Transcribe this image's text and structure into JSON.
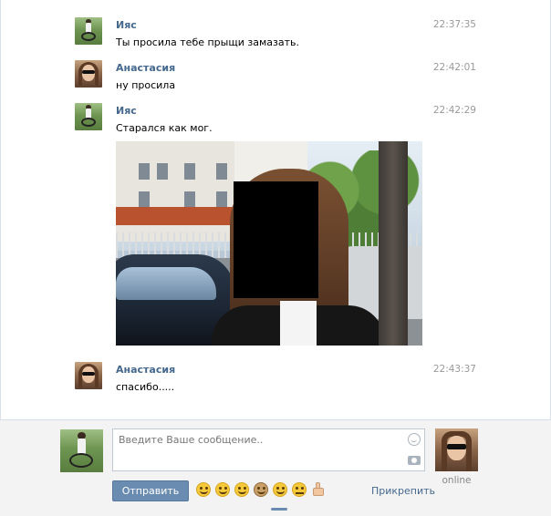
{
  "messages": [
    {
      "author": "Ияс",
      "time": "22:37:35",
      "text": "Ты просила тебе прыщи замазать."
    },
    {
      "author": "Анастасия",
      "time": "22:42:01",
      "text": "ну просила"
    },
    {
      "author": "Ияс",
      "time": "22:42:29",
      "text": "Старался как мог."
    },
    {
      "author": "Анастасия",
      "time": "22:43:37",
      "text": "спасибо....."
    }
  ],
  "composer": {
    "placeholder": "Введите Ваше сообщение..",
    "send_label": "Отправить",
    "attach_label": "Прикрепить",
    "peer_status": "online",
    "emoji": [
      "laughing-emoji",
      "smile-emoji",
      "grin-emoji",
      "cowboy-emoji",
      "cheeky-emoji",
      "neutral-emoji",
      "thumbs-up-emoji"
    ]
  },
  "colors": {
    "author_link": "#45688e",
    "timestamp": "#999999",
    "send_button": "#6a8cb0",
    "composer_bg": "#f3f3f3"
  }
}
